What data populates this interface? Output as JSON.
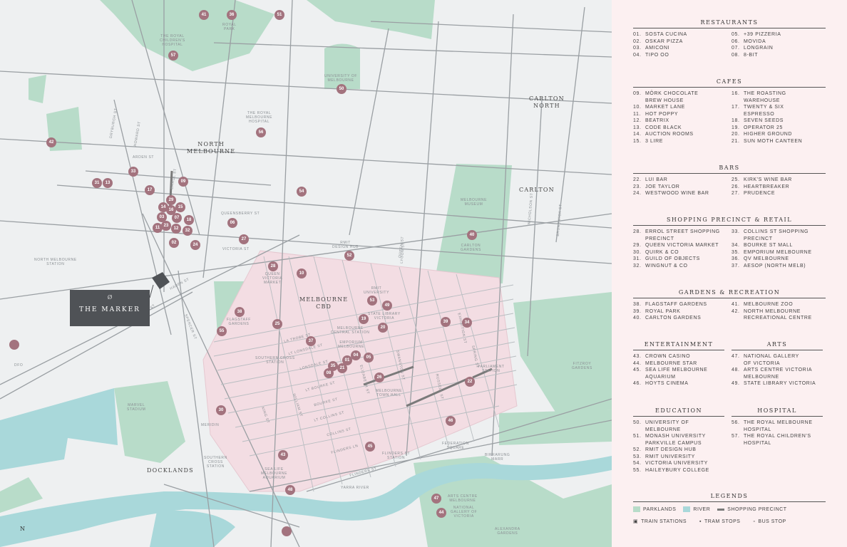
{
  "marker": {
    "logo": "Ø",
    "name": "THE MARKER"
  },
  "north_label": "N",
  "area_labels": [
    "NORTH\nMELBOURNE",
    "MELBOURNE\nCBD",
    "CARLTON",
    "CARLTON\nNORTH",
    "DOCKLANDS"
  ],
  "place_labels": [
    "THE ROYAL\nCHILDREN'S\nHOSPITAL",
    "ROYAL\nPARK",
    "UNIVERSITY OF\nMELBOURNE",
    "THE ROYAL\nMELBOURNE\nHOSPITAL",
    "MELBOURNE\nMUSEUM",
    "CARLTON\nGARDENS",
    "RMIT\nDESIGN HUB",
    "QUEEN\nVICTORIA\nMARKET",
    "FLAGSTAFF\nGARDENS",
    "RMIT\nUNIVERSITY",
    "STATE LIBRARY\nVICTORIA",
    "MELBOURNE\nCENTRAL STATION",
    "EMPORIUM\nMELBOURNE",
    "SOUTHERN CROSS\nSTATION",
    "SOUTHERN\nCROSS\nSTATION",
    "MELBOURNE\nTOWN HALL",
    "PARLIAMENT\nSTATION",
    "FLINDERS ST\nSTATION",
    "FEDERATION\nSQUARE",
    "BIRRARUNG\nMARR",
    "SEA LIFE\nMELBOURNE\nAQUARIUM",
    "ARTS CENTRE\nMELBOURNE",
    "NATIONAL\nGALLERY OF\nVICTORIA",
    "ALEXANDRA\nGARDENS",
    "FITZROY\nGARDENS",
    "MARVEL\nSTADIUM",
    "NORTH MELBOURNE\nSTATION",
    "YARRA RIVER",
    "DFO",
    "MERIDIN"
  ],
  "street_labels": [
    "ERROL ST",
    "HOWARD ST",
    "DRYBURGH ST",
    "ARDEN ST",
    "QUEENSBERRY ST",
    "VICTORIA ST",
    "HADEN ST",
    "SPENCER ST",
    "KING ST",
    "WILLIAM ST",
    "QUEEN ST",
    "ELIZABETH ST",
    "SWANSTON ST",
    "RUSSELL ST",
    "EXHIBITION ST",
    "SPRING ST",
    "LA TROBE ST",
    "LT LONSDALE ST",
    "LONSDALE ST",
    "LT BOURKE ST",
    "BOURKE ST",
    "COLLINS ST",
    "FLINDERS LN",
    "FLINDERS ST",
    "LYGON ST",
    "NICHOLSON ST",
    "BRUNSWICK ST",
    "DUDLEY ST",
    "LT COLLINS ST"
  ],
  "markers": [
    "41",
    "36",
    "51",
    "57",
    "42",
    "33",
    "31",
    "13",
    "09",
    "17",
    "29",
    "14",
    "15",
    "16",
    "03",
    "07",
    "18",
    "11",
    "23",
    "32",
    "12",
    "02",
    "24",
    "06",
    "27",
    "56",
    "50",
    "52",
    "54",
    "53",
    "40",
    "28",
    "10",
    "30",
    "38",
    "49",
    "25",
    "19",
    "20",
    "39",
    "55",
    "37",
    "34",
    "04",
    "05",
    "35",
    "21",
    "01",
    "26",
    "08",
    "22",
    "46",
    "45",
    "43",
    "48",
    "47",
    "44"
  ],
  "sections": {
    "restaurants": {
      "title": "RESTAURANTS",
      "left": [
        [
          "01.",
          "SOSTA CUCINA"
        ],
        [
          "02.",
          "OSKAR PIZZA"
        ],
        [
          "03.",
          "AMICONI"
        ],
        [
          "04.",
          "TIPO OO"
        ]
      ],
      "right": [
        [
          "05.",
          "+39 PIZZERIA"
        ],
        [
          "06.",
          "MOVIDA"
        ],
        [
          "07.",
          "LONGRAIN"
        ],
        [
          "08.",
          "8-BIT"
        ]
      ]
    },
    "cafes": {
      "title": "CAFES",
      "left": [
        [
          "09.",
          "MÖRK CHOCOLATE\nBREW HOUSE"
        ],
        [
          "10.",
          "MARKET LANE"
        ],
        [
          "11.",
          "HOT POPPY"
        ],
        [
          "12.",
          "BEATRIX"
        ],
        [
          "13.",
          "CODE BLACK"
        ],
        [
          "14.",
          "AUCTION ROOMS"
        ],
        [
          "15.",
          "3 LIRE"
        ]
      ],
      "right": [
        [
          "16.",
          "THE ROASTING\nWAREHOUSE"
        ],
        [
          "17.",
          "TWENTY & SIX\nESPRESSO"
        ],
        [
          "18.",
          "SEVEN SEEDS"
        ],
        [
          "19.",
          "OPERATOR 25"
        ],
        [
          "20.",
          "HIGHER GROUND"
        ],
        [
          "21.",
          "SUN MOTH CANTEEN"
        ]
      ]
    },
    "bars": {
      "title": "BARS",
      "left": [
        [
          "22.",
          "LUI BAR"
        ],
        [
          "23.",
          "JOE TAYLOR"
        ],
        [
          "24.",
          "WESTWOOD WINE BAR"
        ]
      ],
      "right": [
        [
          "25.",
          "KIRK'S WINE BAR"
        ],
        [
          "26.",
          "HEARTBREAKER"
        ],
        [
          "27.",
          "PRUDENCE"
        ]
      ]
    },
    "shopping": {
      "title": "SHOPPING PRECINCT & RETAIL",
      "left": [
        [
          "28.",
          "ERROL STREET SHOPPING\nPRECINCT"
        ],
        [
          "29.",
          "QUEEN VICTORIA MARKET"
        ],
        [
          "30.",
          "QUIRK & CO"
        ],
        [
          "31.",
          "GUILD OF OBJECTS"
        ],
        [
          "32.",
          "WINGNUT & CO"
        ]
      ],
      "right": [
        [
          "33.",
          "COLLINS ST SHOPPING\nPRECINCT"
        ],
        [
          "34.",
          "BOURKE ST MALL"
        ],
        [
          "35.",
          "EMPORIUM MELBOURNE"
        ],
        [
          "36.",
          "QV MELBOURNE"
        ],
        [
          "37.",
          "AESOP (NORTH MELB)"
        ]
      ]
    },
    "gardens": {
      "title": "GARDENS & RECREATION",
      "left": [
        [
          "38.",
          "FLAGSTAFF GARDENS"
        ],
        [
          "39.",
          "ROYAL PARK"
        ],
        [
          "40.",
          "CARLTON GARDENS"
        ]
      ],
      "right": [
        [
          "41.",
          "MELBOURNE ZOO"
        ],
        [
          "42.",
          "NORTH MELBOURNE\nRECREATIONAL CENTRE"
        ]
      ]
    },
    "entertainment": {
      "title": "ENTERTAINMENT",
      "items": [
        [
          "43.",
          "CROWN CASINO"
        ],
        [
          "44.",
          "MELBOURNE STAR"
        ],
        [
          "45.",
          "SEA LIFE MELBOURNE\nAQUARIUM"
        ],
        [
          "46.",
          "HOYTS CINEMA"
        ]
      ]
    },
    "arts": {
      "title": "ARTS",
      "items": [
        [
          "47.",
          "NATIONAL GALLERY\nOF VICTORIA"
        ],
        [
          "48.",
          "ARTS CENTRE VICTORIA\nMELBOURNE"
        ],
        [
          "49.",
          "STATE LIBRARY VICTORIA"
        ]
      ]
    },
    "education": {
      "title": "EDUCATION",
      "items": [
        [
          "50.",
          "UNIVERSITY OF\nMELBOURNE"
        ],
        [
          "51.",
          "MONASH UNIVERSITY\nPARKVILLE CAMPUS"
        ],
        [
          "52.",
          "RMIT DESIGN HUB"
        ],
        [
          "53.",
          "RMIT UNIVERSITY"
        ],
        [
          "54.",
          "VICTORIA UNIVERSITY"
        ],
        [
          "55.",
          "HAILEYBURY COLLEGE"
        ]
      ]
    },
    "hospital": {
      "title": "HOSPITAL",
      "items": [
        [
          "56.",
          "THE ROYAL MELBOURNE\nHOSPITAL"
        ],
        [
          "57.",
          "THE ROYAL CHILDREN'S\nHOSPITAL"
        ]
      ]
    }
  },
  "legends": {
    "title": "LEGENDS",
    "parklands": "PARKLANDS",
    "river": "RIVER",
    "shopping": "SHOPPING PRECINCT",
    "train": "TRAIN STATIONS",
    "tram": "TRAM STOPS",
    "bus": "BUS STOP",
    "colors": {
      "parklands": "#b8dcc9",
      "river": "#a9d8da",
      "shopping": "#7a7a7a",
      "cbd": "#f3dde3",
      "marker": "#a3737e"
    }
  }
}
